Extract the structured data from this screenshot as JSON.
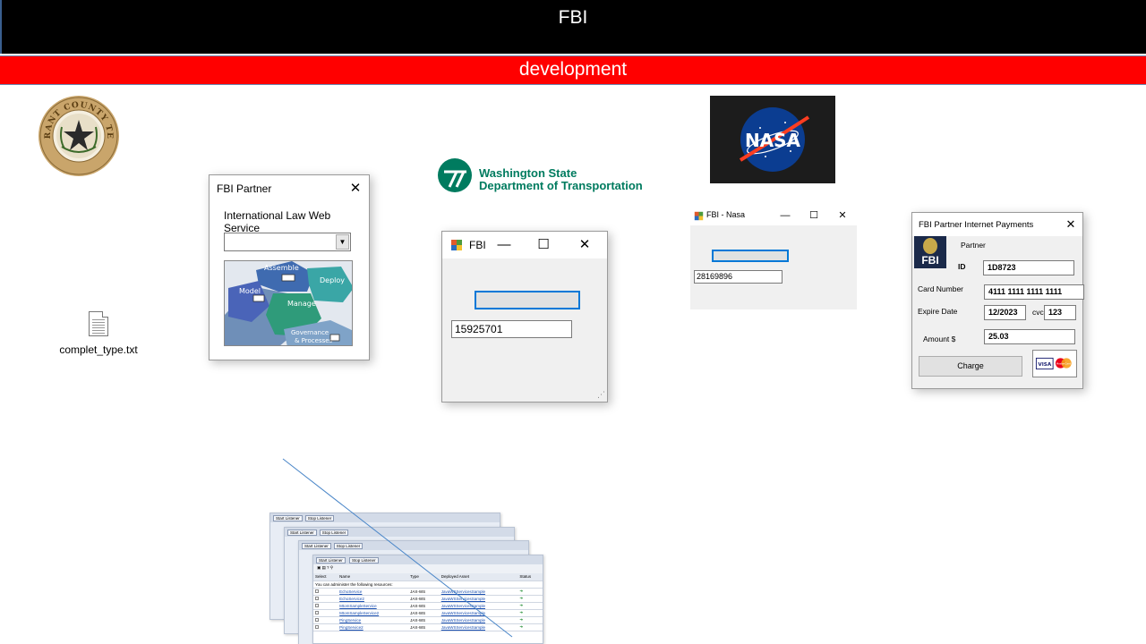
{
  "header": {
    "title": "FBI",
    "subtitle": "development"
  },
  "desktop_file": {
    "name": "complet_type.txt",
    "icon": "text-file-icon"
  },
  "seal": {
    "text": "TARRANT COUNTY TEXAS"
  },
  "wsdot": {
    "line1": "Washington State",
    "line2": "Department of Transportation"
  },
  "nasa": {
    "text": "NASA"
  },
  "partner_window": {
    "title": "FBI Partner",
    "heading": "International Law Web Service",
    "combo_value": "",
    "diagram": {
      "assemble": "Assemble",
      "deploy": "Deploy",
      "model": "Model",
      "manage": "Manage",
      "governance": "Governance",
      "processes": "& Processes"
    }
  },
  "fbi_window": {
    "title": "FBI",
    "field_value": "15925701"
  },
  "nasa_window": {
    "title": "FBI - Nasa",
    "field_value": "28169896"
  },
  "payments_window": {
    "title": "FBI Partner Internet Payments",
    "badge": "FBI",
    "partner_label": "Partner",
    "id_label": "ID",
    "id_value": "1D8723",
    "card_label": "Card Number",
    "card_value": "4111 1111 1111 1111",
    "expire_label": "Expire Date",
    "expire_value": "12/2023",
    "cvc_label": "cvc",
    "cvc_value": "123",
    "amount_label": "Amount $",
    "amount_value": "25.03",
    "charge_label": "Charge",
    "cards": {
      "visa": "VISA",
      "mastercard": "MasterCard"
    }
  },
  "listener_stack": {
    "start_label": "Start Listener",
    "stop_label": "Stop Listener",
    "columns": [
      "Select",
      "Name",
      "Type",
      "Deployed Asset",
      "Status"
    ],
    "admin_note": "You can administer the following resources:",
    "rows": [
      {
        "name": "EchoService",
        "type": "JAX-WS",
        "asset": "JavaWSServicesSample"
      },
      {
        "name": "EchoService2",
        "type": "JAX-WS",
        "asset": "JavaWSServicesSample"
      },
      {
        "name": "MtomSampleService",
        "type": "JAX-WS",
        "asset": "JavaWSServicesSample"
      },
      {
        "name": "MtomSampleService2",
        "type": "JAX-WS",
        "asset": "JavaWSServicesSample"
      },
      {
        "name": "PingService",
        "type": "JAX-WS",
        "asset": "JavaWSServicesSample"
      },
      {
        "name": "PingService2",
        "type": "JAX-WS",
        "asset": "JavaWSServicesSample"
      }
    ],
    "total_label": "Total"
  },
  "colors": {
    "header_bg": "#000000",
    "subheader_bg": "#ff0000",
    "focus_blue": "#0078d7",
    "wsdot_green": "#007b5f",
    "nasa_blue": "#0b3d91",
    "nasa_red": "#fc3d21"
  }
}
